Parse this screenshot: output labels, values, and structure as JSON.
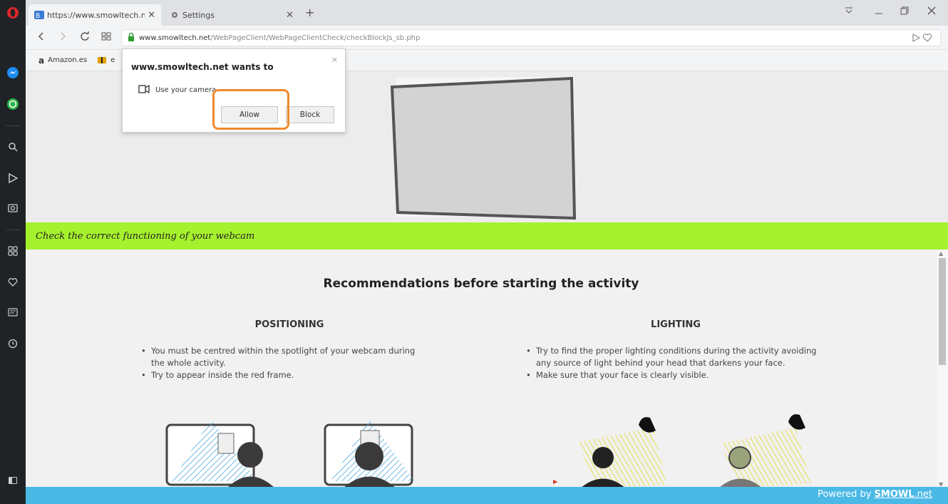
{
  "tabs": [
    {
      "label": "https://www.smowltech.ne",
      "close": "✕",
      "icon": "page-icon"
    },
    {
      "label": "Settings",
      "close": "✕",
      "icon": "gear-icon"
    }
  ],
  "new_tab": "+",
  "url": {
    "host": "www.smowltech.net",
    "path": "/WebPageClient/WebPageClientCheck/checkBlockJs_sb.php"
  },
  "bookmarks": [
    {
      "icon": "a",
      "label": "Amazon.es"
    },
    {
      "icon": "",
      "label": "e"
    }
  ],
  "popup": {
    "title": "www.smowltech.net wants to",
    "close": "×",
    "permission": "Use your camera",
    "allow": "Allow",
    "block": "Block"
  },
  "page": {
    "banner": "Check the correct functioning of your webcam",
    "rec_title": "Recommendations before starting the activity",
    "positioning": {
      "heading": "POSITIONING",
      "items": [
        "You must be centred within the spotlight of your webcam during the whole activity.",
        "Try to appear inside the red frame."
      ]
    },
    "lighting": {
      "heading": "LIGHTING",
      "items": [
        "Try to find the proper lighting conditions during the activity avoiding any source of light behind your head that darkens your face.",
        "Make sure that your face is clearly visible."
      ]
    },
    "footer_prefix": "Powered by ",
    "footer_brand": "SMOWL",
    "footer_suffix": ".net"
  },
  "colors": {
    "accent_green": "#a6f12d",
    "footer_blue": "#4ab9e6",
    "highlight_orange": "#f08a2c"
  }
}
